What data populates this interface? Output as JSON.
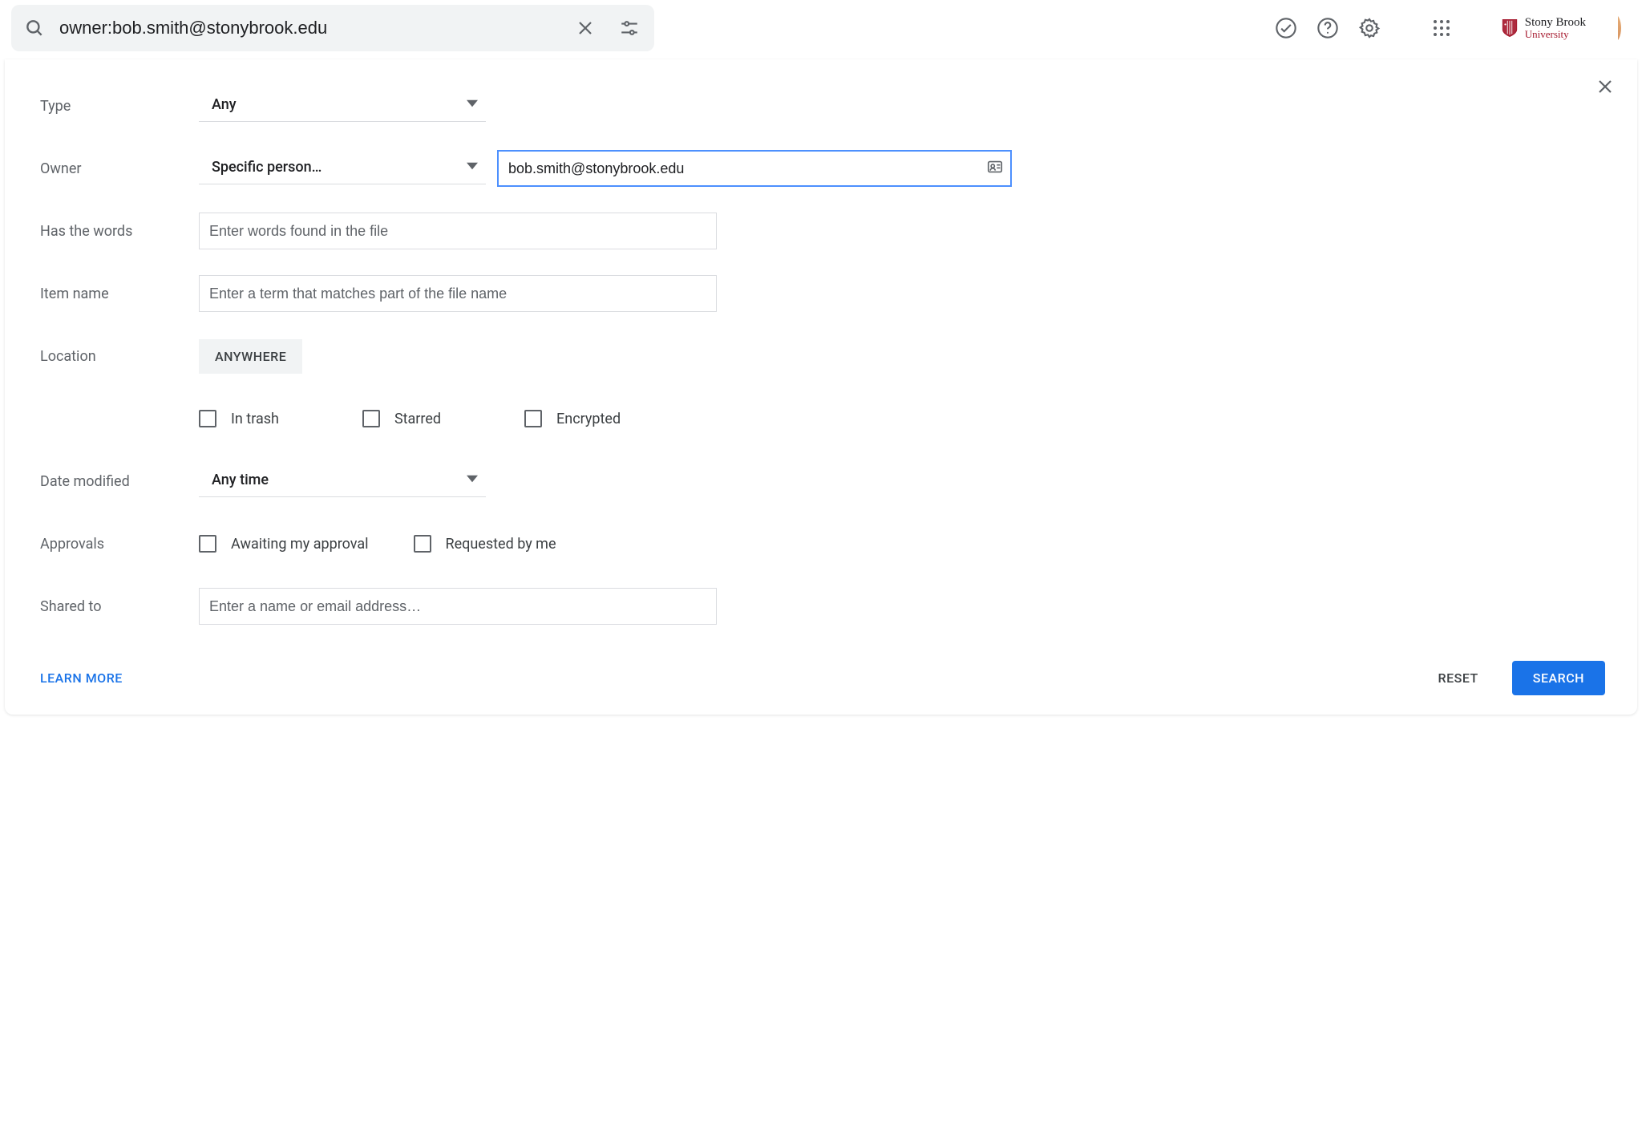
{
  "search": {
    "query": "owner:bob.smith@stonybrook.edu"
  },
  "brand": {
    "line1": "Stony Brook",
    "line2": "University"
  },
  "panel": {
    "type": {
      "label": "Type",
      "value": "Any"
    },
    "owner": {
      "label": "Owner",
      "value": "Specific person…",
      "email": "bob.smith@stonybrook.edu"
    },
    "hasWords": {
      "label": "Has the words",
      "placeholder": "Enter words found in the file"
    },
    "itemName": {
      "label": "Item name",
      "placeholder": "Enter a term that matches part of the file name"
    },
    "location": {
      "label": "Location",
      "chip": "ANYWHERE"
    },
    "locationChecks": {
      "inTrash": "In trash",
      "starred": "Starred",
      "encrypted": "Encrypted"
    },
    "dateModified": {
      "label": "Date modified",
      "value": "Any time"
    },
    "approvals": {
      "label": "Approvals",
      "awaiting": "Awaiting my approval",
      "requested": "Requested by me"
    },
    "sharedTo": {
      "label": "Shared to",
      "placeholder": "Enter a name or email address…"
    }
  },
  "footer": {
    "learnMore": "LEARN MORE",
    "reset": "RESET",
    "search": "SEARCH"
  }
}
